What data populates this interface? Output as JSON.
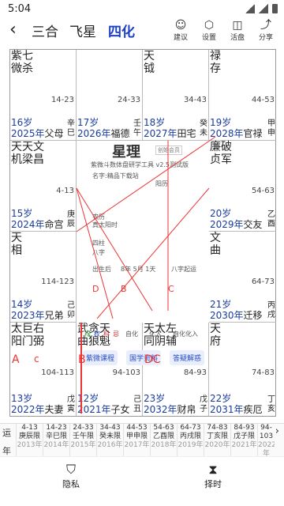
{
  "status": {
    "time": "5:04"
  },
  "header": {
    "tabs": [
      "三合",
      "飞星",
      "四化"
    ],
    "buttons": [
      {
        "label": "建议",
        "icon": "user-chat-icon"
      },
      {
        "label": "设置",
        "icon": "gear-icon"
      },
      {
        "label": "活盘",
        "icon": "layers-icon"
      },
      {
        "label": "分享",
        "icon": "share-icon"
      }
    ]
  },
  "palaces": [
    {
      "stars": [
        "紫七",
        "微杀"
      ],
      "range": "14-23",
      "age": "16岁",
      "year": "2025年",
      "palace": "父母",
      "gz": [
        "辛",
        "巳"
      ]
    },
    {
      "stars": [],
      "range": "24-33",
      "age": "17岁",
      "year": "2026年",
      "palace": "福德",
      "gz": [
        "壬",
        "午"
      ]
    },
    {
      "stars": [
        "天",
        "钺"
      ],
      "range": "34-43",
      "age": "18岁",
      "year": "2027年",
      "palace": "田宅",
      "gz": [
        "癸",
        "未"
      ]
    },
    {
      "stars": [
        "禄",
        "存"
      ],
      "range": "44-53",
      "age": "19岁",
      "year": "2028年",
      "palace": "官禄",
      "gz": [
        "甲",
        "申"
      ]
    },
    {
      "stars": [
        "天天文",
        "机梁昌"
      ],
      "range": "4-13",
      "age": "15岁",
      "year": "2024年",
      "palace": "命宫",
      "gz": [
        "庚",
        "辰"
      ]
    },
    {
      "stars": [
        "廉破",
        "贞军"
      ],
      "range": "54-63",
      "age": "20岁",
      "year": "2029年",
      "palace": "交友",
      "gz": [
        "乙",
        "酉"
      ]
    },
    {
      "stars": [
        "天",
        "相"
      ],
      "range": "114-123",
      "age": "14岁",
      "year": "2023年",
      "palace": "兄弟",
      "gz": [
        "己",
        "卯"
      ]
    },
    {
      "stars": [
        "文",
        "曲"
      ],
      "range": "64-73",
      "age": "21岁",
      "year": "2030年",
      "palace": "迁移",
      "gz": [
        "丙",
        "戌"
      ]
    },
    {
      "stars": [
        "太巨右",
        "阳门弼"
      ],
      "range": "104-113",
      "age": "13岁",
      "year": "2022年",
      "palace": "夫妻",
      "gz": [
        "戊",
        "寅"
      ]
    },
    {
      "stars": [
        "武贪天",
        "曲狼魁"
      ],
      "range": "94-103",
      "age": "12岁",
      "year": "2021年",
      "palace": "子女",
      "gz": [
        "己",
        "丑"
      ]
    },
    {
      "stars": [
        "天太左",
        "同阴辅"
      ],
      "range": "84-93",
      "age": "23岁",
      "year": "2032年",
      "palace": "财帛",
      "gz": [
        "戊",
        "子"
      ]
    },
    {
      "stars": [
        "天",
        "府"
      ],
      "range": "74-83",
      "age": "22岁",
      "year": "2031年",
      "palace": "疾厄",
      "gz": [
        "丁",
        "亥"
      ]
    }
  ],
  "center": {
    "logo": "星理",
    "logo_sub": "创始会员",
    "subtitle": "紫微斗数体盘研学工具 v2.5测试版",
    "lines": [
      "名字:精品下载站",
      "阳历",
      "农历",
      "真太阳时",
      "四柱",
      "八字",
      "出生后",
      "8年 5月 1天",
      "八字起运"
    ],
    "sihua": [
      "禄",
      "权",
      "科",
      "忌",
      "自化",
      "化入",
      "自化化入"
    ],
    "buttons": [
      "紫微课程",
      "国学资料",
      "答疑解惑"
    ]
  },
  "timeline": {
    "row_labels": [
      "运",
      "年"
    ],
    "cells": [
      {
        "range": "4-13",
        "name": "庚辰限",
        "year": "2013年"
      },
      {
        "range": "14-23",
        "name": "辛巳限",
        "year": "2014年"
      },
      {
        "range": "24-33",
        "name": "壬午限",
        "year": "2015年"
      },
      {
        "range": "34-43",
        "name": "癸未限",
        "year": "2016年"
      },
      {
        "range": "44-53",
        "name": "甲申限",
        "year": "2017年"
      },
      {
        "range": "54-63",
        "name": "乙酉限",
        "year": "2018年"
      },
      {
        "range": "64-73",
        "name": "丙戌限",
        "year": "2019年"
      },
      {
        "range": "74-83",
        "name": "丁亥限",
        "year": "2020年"
      },
      {
        "range": "84-93",
        "name": "戊子限",
        "year": "2021年"
      },
      {
        "range": "94-103",
        "name": "",
        "year": "2022年"
      }
    ]
  },
  "bottombar": [
    {
      "label": "隐私",
      "icon": "shield-check-icon"
    },
    {
      "label": "择时",
      "icon": "hourglass-icon"
    }
  ],
  "markers": {
    "a": "A",
    "b": "B",
    "c": "C",
    "d": "D",
    "lc": "c",
    "dc": "DC"
  }
}
